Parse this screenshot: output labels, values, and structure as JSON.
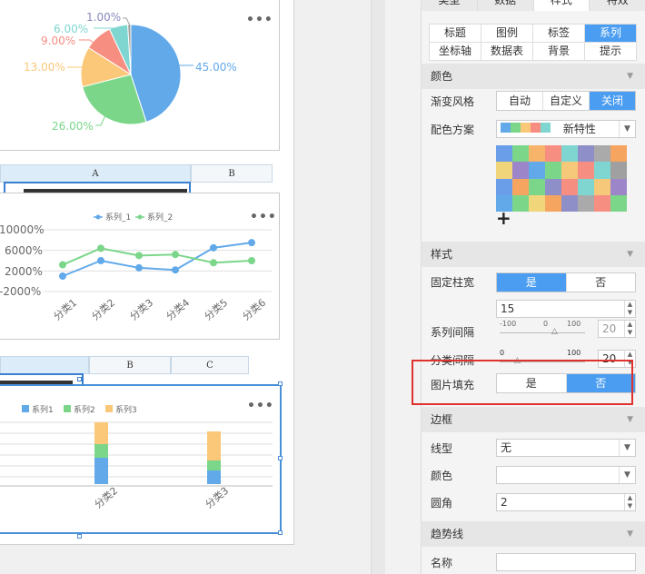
{
  "pie": {
    "labels": [
      "1.00%",
      "6.00%",
      "9.00%",
      "13.00%",
      "26.00%",
      "45.00%"
    ],
    "colors": {
      "s1": "#62a9ea",
      "s2": "#7bd68a",
      "s3": "#fbc87a",
      "s4": "#f78e82",
      "s5": "#7fd6d0",
      "s6": "#a0a0a0"
    }
  },
  "line_chart": {
    "legend": [
      "系列_1",
      "系列_2"
    ],
    "yticks": [
      "10000%",
      "6000%",
      "2000%",
      "-2000%"
    ],
    "categories": [
      "分类1",
      "分类2",
      "分类3",
      "分类4",
      "分类5",
      "分类6"
    ],
    "series1": [
      1000,
      4000,
      2600,
      2200,
      6500,
      7500
    ],
    "series2": [
      3200,
      6400,
      5000,
      5200,
      3600,
      4000
    ],
    "colors": [
      "#62a9ea",
      "#7bd68a"
    ]
  },
  "bar_chart": {
    "legend": [
      "系列1",
      "系列2",
      "系列3"
    ],
    "categories": [
      "分类2",
      "分类3"
    ],
    "colors": [
      "#62a9ea",
      "#7bd68a",
      "#fbc87a"
    ]
  },
  "sheet": {
    "col_a": "A",
    "col_b": "B",
    "col_b2": "B",
    "col_c": "C",
    "more": "•••"
  },
  "panel": {
    "top_tabs": [
      "类型",
      "数据",
      "样式",
      "特效"
    ],
    "sub_tabs": [
      "标题",
      "图例",
      "标签",
      "系列",
      "坐标轴",
      "数据表",
      "背景",
      "提示"
    ],
    "color_section": "颜色",
    "gradient_label": "渐变风格",
    "gradient_opts": [
      "自动",
      "自定义",
      "关闭"
    ],
    "scheme_label": "配色方案",
    "scheme_value": "新特性",
    "palette": [
      "#6a9ee9",
      "#7bd68a",
      "#f5b46a",
      "#f78e82",
      "#7fd6d0",
      "#8e8ec9",
      "#aaaaaa",
      "#f5a55f",
      "#f0d57b",
      "#9c86c9",
      "#62a9ea",
      "#7bd68a",
      "#f5c87a",
      "#f78e82",
      "#7fd6d0",
      "#a0a0a0",
      "#6a9ee9",
      "#f5a55f",
      "#7bd68a",
      "#8e8ec9",
      "#f78e82",
      "#7fd6d0",
      "#f5c87a",
      "#9c86c9",
      "#62a9ea",
      "#7bd68a",
      "#f0d57b",
      "#f5a55f",
      "#8e8ec9",
      "#aaaaaa",
      "#f78e82",
      "#7bd68a"
    ],
    "add": "+",
    "style_section": "样式",
    "fixed_width_label": "固定柱宽",
    "yes": "是",
    "no": "否",
    "width_value": "15",
    "series_gap_label": "系列间隔",
    "series_gap_ticks": [
      "-100",
      "0",
      "100"
    ],
    "series_gap_value": "20",
    "cat_gap_label": "分类间隔",
    "cat_gap_ticks": [
      "0",
      "100"
    ],
    "cat_gap_value": "20",
    "image_fill_label": "图片填充",
    "border_section": "边框",
    "line_type_label": "线型",
    "line_type_value": "无",
    "border_color_label": "颜色",
    "corner_label": "圆角",
    "corner_value": "2",
    "trend_section": "趋势线",
    "name_label": "名称"
  }
}
